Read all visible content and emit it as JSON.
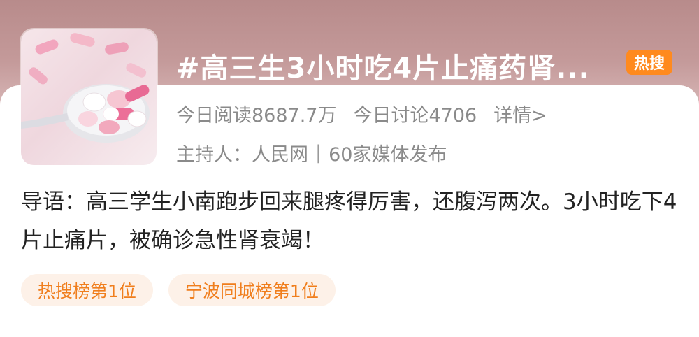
{
  "topic": {
    "title": "#高三生3小时吃4片止痛药肾...",
    "hot_badge": "热搜",
    "thumbnail_icon": "pills-on-spoon-icon"
  },
  "stats": {
    "reads": "今日阅读8687.7万",
    "discussions": "今日讨论4706",
    "details_link": "详情>"
  },
  "host": {
    "label": "主持人：",
    "name": "人民网",
    "separator": "|",
    "media": "60家媒体发布"
  },
  "intro": {
    "text": "导语：高三学生小南跑步回来腿疼得厉害，还腹泻两次。3小时吃下4片止痛片，被确诊急性肾衰竭！"
  },
  "tags": [
    {
      "label": "热搜榜第1位"
    },
    {
      "label": "宁波同城榜第1位"
    }
  ],
  "colors": {
    "accent": "#ff8a1e",
    "tag_text": "#f07e1d",
    "tag_bg": "#fdf1e8",
    "muted_text": "#8a8a8a"
  }
}
